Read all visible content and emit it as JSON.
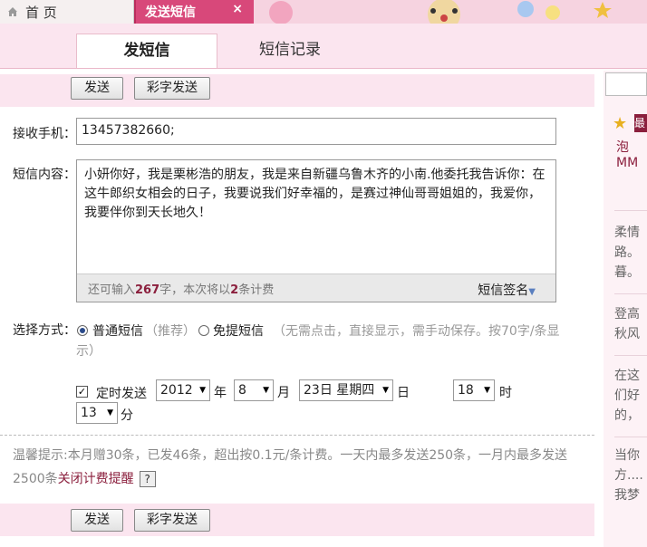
{
  "tabs": {
    "home": "首 页",
    "sms": "发送短信",
    "close": "×"
  },
  "subtabs": {
    "send": "发短信",
    "records": "短信记录"
  },
  "toolbar": {
    "send": "发送",
    "mms_send": "彩字发送"
  },
  "form": {
    "recipient_label": "接收手机：",
    "recipient_value": "13457382660;",
    "content_label": "短信内容：",
    "content_lines": [
      "小妍你好，我是栗彬浩的朋友，我是来自新疆乌鲁木齐的小南.他委托我告诉你：在",
      "这牛郎织女相会的日子，我要说我们好幸福的，是赛过神仙哥哥姐姐的，我爱你，",
      "我要伴你到天长地久！"
    ],
    "remain_prefix": "还可输入",
    "remain_count": "267",
    "remain_mid": "字，本次将以",
    "remain_sms": "2",
    "remain_suffix": "条计费",
    "signature": "短信签名",
    "method_label": "选择方式：",
    "method_normal": "普通短信",
    "method_normal_note": "（推荐）",
    "method_free": "免提短信",
    "method_free_note": "（无需点击，直接显示，需手动保存。按70字/条显",
    "method_free_note2": "示）",
    "scheduled_label": "定时发送",
    "year_value": "2012",
    "year_unit": "年",
    "month_value": "8",
    "month_unit": "月",
    "day_value": "23日 星期四",
    "day_unit": "日",
    "hour_value": "18",
    "hour_unit": "时",
    "minute_value": "13",
    "minute_unit": "分",
    "check_mark": "✓"
  },
  "tip": {
    "line1": "温馨提示:本月赠30条，已发46条，超出按0.1元/条计费。一天内最多发送250条，一月内最多发送",
    "line2_prefix": "2500条",
    "line2_link": "关闭计费提醒",
    "help": "?"
  },
  "sidebar": {
    "star": "★",
    "badge": "最",
    "link": "泡MM",
    "items": [
      "柔情",
      "路。",
      "暮。",
      "登高",
      "秋风",
      "在这",
      "们好",
      "的，",
      "当你",
      "方....",
      "我梦"
    ]
  },
  "colors": {
    "accent": "#b92d5c",
    "tab_active": "#d8487a",
    "toolbar_bg": "#fbe5ef",
    "link": "#8b1f3d"
  }
}
